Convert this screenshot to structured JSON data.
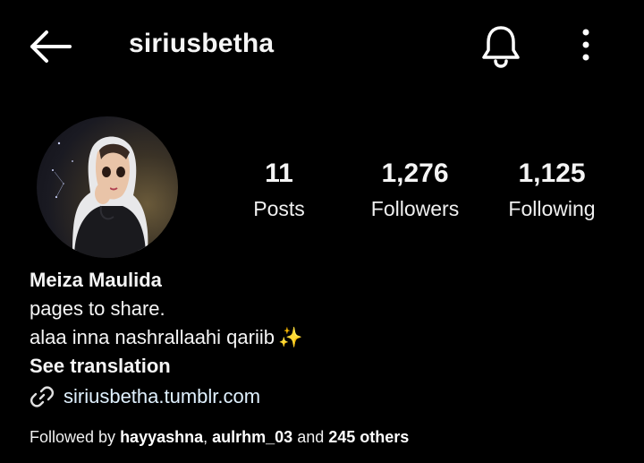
{
  "header": {
    "back_icon": "arrow-left-icon",
    "username": "siriusbetha",
    "bell_icon": "bell-icon",
    "menu_icon": "more-vertical-icon"
  },
  "profile": {
    "avatar": "profile-picture",
    "stats": [
      {
        "count": "11",
        "label": "Posts"
      },
      {
        "count": "1,276",
        "label": "Followers"
      },
      {
        "count": "1,125",
        "label": "Following"
      }
    ]
  },
  "bio": {
    "name": "Meiza Maulida",
    "line1": "pages to share.",
    "line2": "alaa inna nashrallaahi qariib",
    "sparkle": "✨",
    "see_translation": "See translation",
    "link_icon": "link-icon",
    "link": "siriusbetha.tumblr.com"
  },
  "followed_by": {
    "prefix": "Followed by ",
    "user1": "hayyashna",
    "sep1": ", ",
    "user2": "aulrhm_03",
    "sep2": " and ",
    "others": "245 others"
  },
  "colors": {
    "background": "#000000",
    "text": "#f5f5f5",
    "sparkle": "#f4d35e"
  }
}
